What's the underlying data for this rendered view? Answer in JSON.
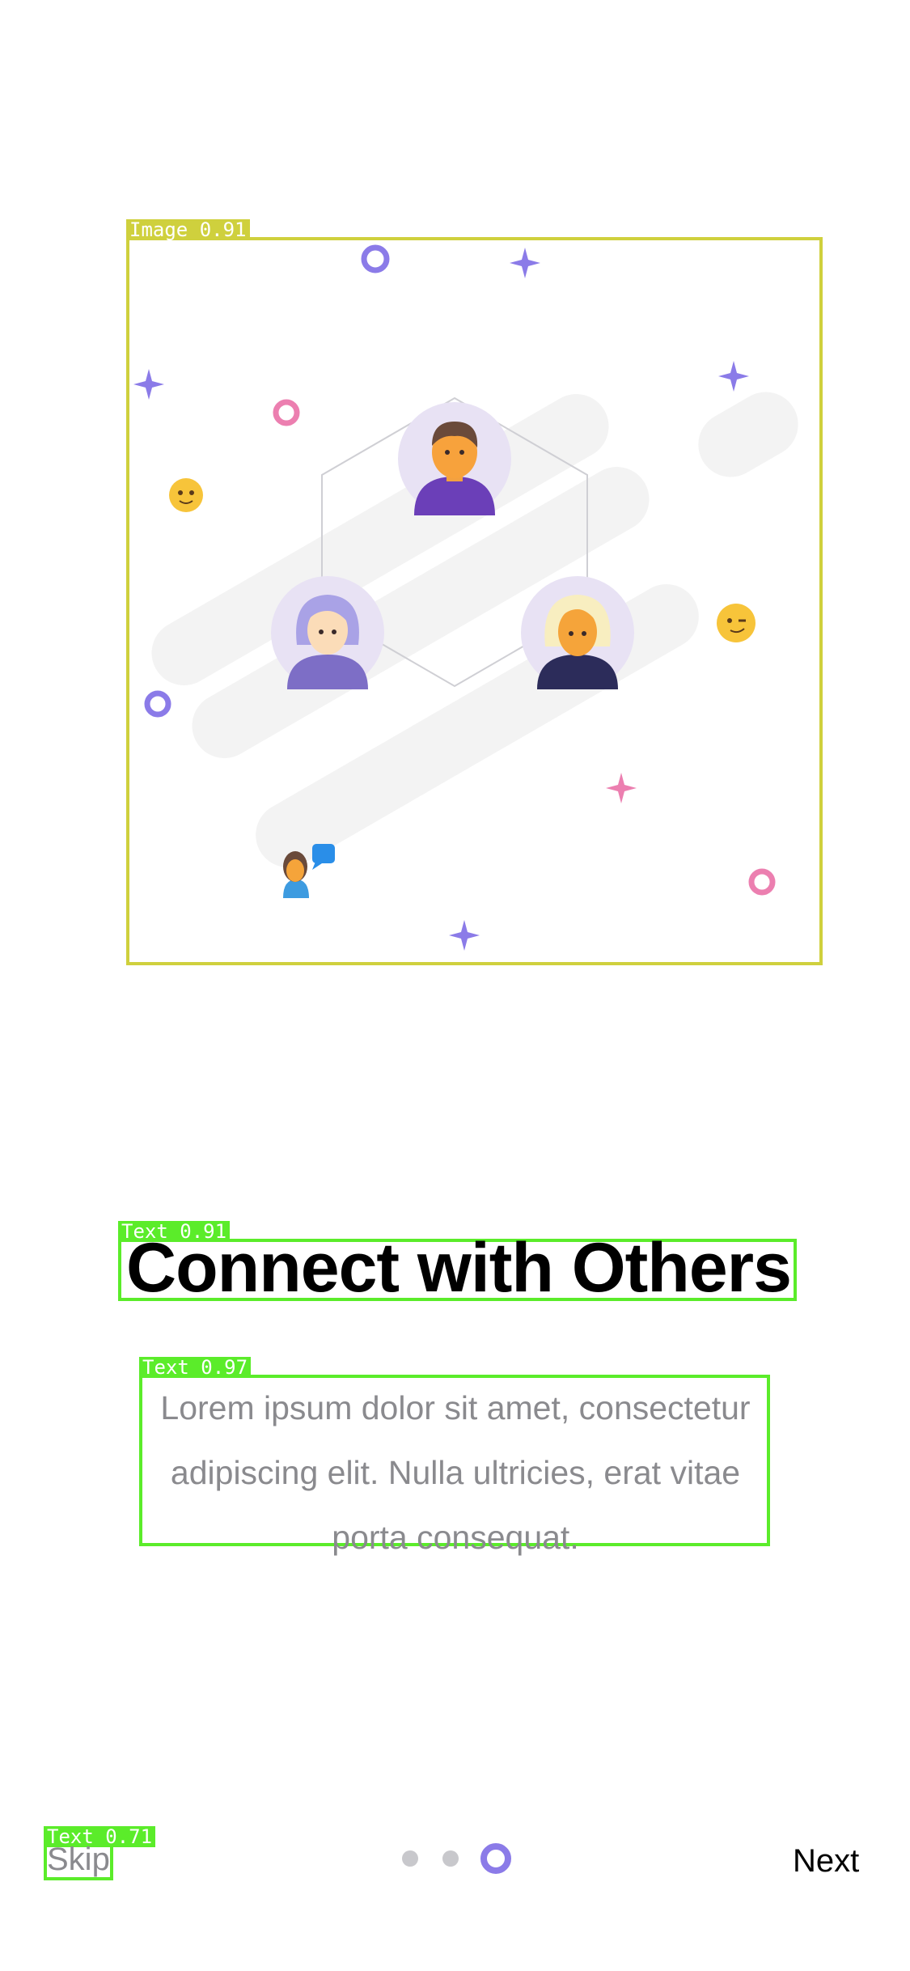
{
  "detections": {
    "image_label": "Image 0.91",
    "title_label": "Text 0.91",
    "body_label": "Text 0.97",
    "skip_label": "Text 0.71"
  },
  "onboarding": {
    "title": "Connect with Others",
    "description": "Lorem ipsum dolor sit amet, consectetur adipiscing elit. Nulla ultricies, erat vitae porta consequat."
  },
  "footer": {
    "skip": "Skip",
    "next": "Next",
    "pages_total": 3,
    "current_page": 3
  },
  "colors": {
    "accent": "#8b7be8",
    "inactive_dot": "#c8c8cc",
    "pink": "#ec7fb0",
    "purple": "#8b7be8"
  }
}
